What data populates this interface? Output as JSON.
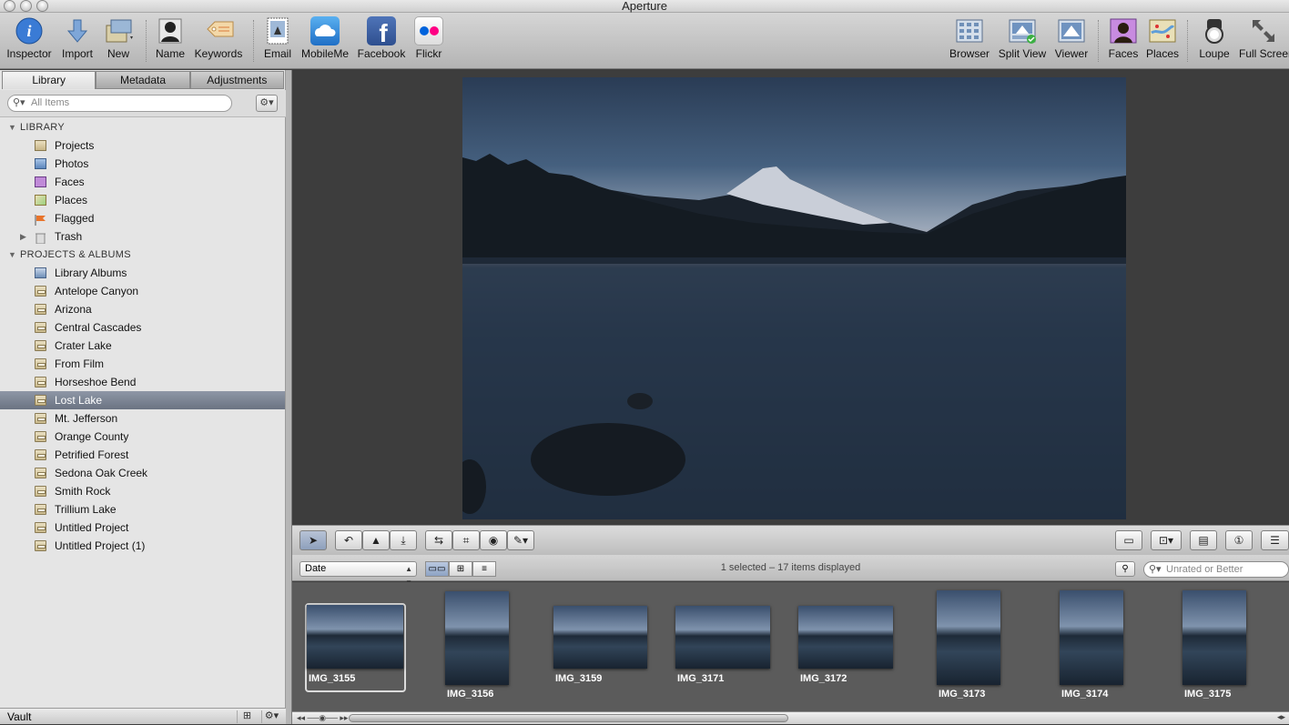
{
  "app": {
    "title": "Aperture"
  },
  "toolbar": {
    "left": [
      {
        "label": "Inspector",
        "icon": "info-icon"
      },
      {
        "label": "Import",
        "icon": "import-arrow-icon"
      },
      {
        "label": "New",
        "icon": "new-project-icon"
      },
      {
        "label": "Name",
        "icon": "name-person-icon"
      },
      {
        "label": "Keywords",
        "icon": "keywords-tag-icon"
      },
      {
        "label": "Email",
        "icon": "email-stamp-icon"
      },
      {
        "label": "MobileMe",
        "icon": "mobileme-cloud-icon"
      },
      {
        "label": "Facebook",
        "icon": "facebook-icon"
      },
      {
        "label": "Flickr",
        "icon": "flickr-icon"
      }
    ],
    "right": [
      {
        "label": "Browser",
        "icon": "browser-grid-icon"
      },
      {
        "label": "Split View",
        "icon": "split-view-icon"
      },
      {
        "label": "Viewer",
        "icon": "viewer-icon"
      },
      {
        "label": "Faces",
        "icon": "faces-icon"
      },
      {
        "label": "Places",
        "icon": "places-map-icon"
      },
      {
        "label": "Loupe",
        "icon": "loupe-icon"
      },
      {
        "label": "Full Screen",
        "icon": "full-screen-arrows-icon"
      }
    ]
  },
  "sidebar": {
    "tabs": [
      "Library",
      "Metadata",
      "Adjustments"
    ],
    "search_placeholder": "All Items",
    "library_header": "LIBRARY",
    "library_items": [
      "Projects",
      "Photos",
      "Faces",
      "Places",
      "Flagged",
      "Trash"
    ],
    "projects_header": "PROJECTS & ALBUMS",
    "project_items": [
      "Library Albums",
      "Antelope Canyon",
      "Arizona",
      "Central Cascades",
      "Crater Lake",
      "From Film",
      "Horseshoe Bend",
      "Lost Lake",
      "Mt. Jefferson",
      "Orange County",
      "Petrified Forest",
      "Sedona Oak Creek",
      "Smith Rock",
      "Trillium Lake",
      "Untitled Project",
      "Untitled Project (1)"
    ],
    "selected": "Lost Lake",
    "vault_label": "Vault"
  },
  "filter": {
    "sort": "Date",
    "status": "1 selected – 17 items displayed",
    "rating_placeholder": "Unrated or Better"
  },
  "thumbnails": [
    "IMG_3155",
    "IMG_3156",
    "IMG_3159",
    "IMG_3171",
    "IMG_3172",
    "IMG_3173",
    "IMG_3174",
    "IMG_3175"
  ],
  "colors": {
    "selection": "#7a8291",
    "viewer_bg": "#3d3d3d",
    "strip_bg": "#5b5b5b"
  }
}
